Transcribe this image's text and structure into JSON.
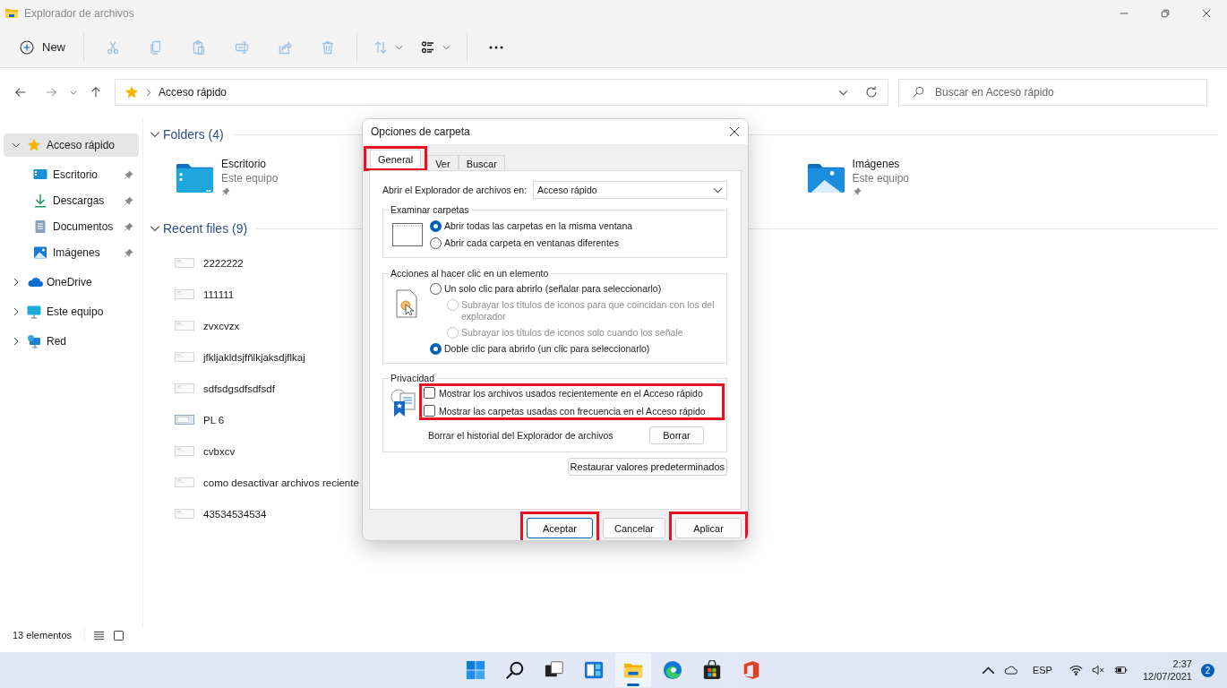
{
  "window": {
    "title": "Explorador de archivos"
  },
  "toolbar": [
    {
      "kind": "new",
      "label": "New",
      "disabled": false
    },
    {
      "kind": "cut",
      "disabled": true
    },
    {
      "kind": "copy",
      "disabled": true
    },
    {
      "kind": "paste",
      "disabled": true
    },
    {
      "kind": "rename",
      "disabled": true
    },
    {
      "kind": "share",
      "disabled": true
    },
    {
      "kind": "delete",
      "disabled": true
    },
    {
      "kind": "sort",
      "disabled": true
    },
    {
      "kind": "view",
      "disabled": false
    },
    {
      "kind": "more",
      "disabled": false
    }
  ],
  "address": {
    "path": "Acceso rápido"
  },
  "search": {
    "placeholder": "Buscar en Acceso rápido"
  },
  "sidebar": {
    "items": [
      {
        "label": "Acceso rápido",
        "kind": "star",
        "expanded": true,
        "selected": true,
        "children": [
          {
            "label": "Escritorio",
            "kind": "desktop",
            "pinned": true,
            "selected": false
          },
          {
            "label": "Descargas",
            "kind": "download",
            "pinned": true,
            "selected": false
          },
          {
            "label": "Documentos",
            "kind": "document",
            "pinned": true,
            "selected": false
          },
          {
            "label": "Imágenes",
            "kind": "image",
            "pinned": true,
            "selected": false
          }
        ]
      },
      {
        "label": "OneDrive",
        "kind": "cloud",
        "expanded": false,
        "selected": false
      },
      {
        "label": "Este equipo",
        "kind": "monitor",
        "expanded": false,
        "selected": false
      },
      {
        "label": "Red",
        "kind": "network",
        "expanded": false,
        "selected": false
      }
    ]
  },
  "folders": {
    "title": "Folders (4)",
    "expanded": true,
    "items": [
      {
        "name": "Escritorio",
        "location": "Este equipo",
        "kind": "desktop",
        "pinned": true
      },
      {
        "name": "Imágenes",
        "location": "Este equipo",
        "kind": "image",
        "pinned": true
      }
    ]
  },
  "recent": {
    "title": "Recent files (9)",
    "expanded": true,
    "files": [
      {
        "name": "2222222",
        "kind": "doc"
      },
      {
        "name": "111111",
        "kind": "doc"
      },
      {
        "name": "zvxcvzx",
        "kind": "doc"
      },
      {
        "name": "jfkljakldsjfñlkjaksdjflkaj",
        "kind": "doc"
      },
      {
        "name": "sdfsdgsdfsdfsdf",
        "kind": "doc"
      },
      {
        "name": "PL 6",
        "kind": "screen"
      },
      {
        "name": "cvbxcv",
        "kind": "doc"
      },
      {
        "name": "como desactivar archivos reciente",
        "kind": "doc"
      },
      {
        "name": "43534534534",
        "kind": "doc"
      }
    ]
  },
  "status_bar": {
    "count": "13 elementos"
  },
  "dialog": {
    "title": "Opciones de carpeta",
    "tabs": [
      {
        "label": "General",
        "selected": true,
        "highlighted": true
      },
      {
        "label": "Ver",
        "selected": false,
        "highlighted": false
      },
      {
        "label": "Buscar",
        "selected": false,
        "highlighted": false
      }
    ],
    "open_in": {
      "label": "Abrir el Explorador de archivos en:",
      "value": "Acceso rápido"
    },
    "groups": [
      {
        "title": "Examinar carpetas",
        "kind": "browse",
        "options": [
          {
            "label": "Abrir todas las carpetas en la misma ventana",
            "selected": true,
            "disabled": false
          },
          {
            "label": "Abrir cada carpeta en ventanas diferentes",
            "selected": false,
            "disabled": false
          }
        ]
      },
      {
        "title": "Acciones al hacer clic en un elemento",
        "kind": "click",
        "options": [
          {
            "label": "Un solo clic para abrirlo (señalar para seleccionarlo)",
            "selected": false,
            "disabled": false,
            "children": [
              {
                "label": "Subrayar los títulos de iconos para que coincidan con los del explorador",
                "selected": false,
                "disabled": true
              },
              {
                "label": "Subrayar los títulos de iconos solo cuando los señale",
                "selected": false,
                "disabled": true
              }
            ]
          },
          {
            "label": "Doble clic para abrirlo (un clic para seleccionarlo)",
            "selected": true,
            "disabled": false
          }
        ]
      },
      {
        "title": "Privacidad",
        "kind": "privacy",
        "highlighted": true,
        "checkboxes": [
          {
            "label": "Mostrar los archivos usados recientemente en el Acceso rápido",
            "checked": false
          },
          {
            "label": "Mostrar las carpetas usadas con frecuencia en el Acceso rápido",
            "checked": false
          }
        ],
        "clear_label": "Borrar el historial del Explorador de archivos",
        "clear_button": "Borrar"
      }
    ],
    "restore_button": "Restaurar valores predeterminados",
    "buttons": [
      {
        "label": "Aceptar",
        "default": true,
        "highlighted": true
      },
      {
        "label": "Cancelar",
        "default": false,
        "highlighted": false
      },
      {
        "label": "Aplicar",
        "default": false,
        "highlighted": true
      }
    ]
  },
  "taskbar": {
    "apps": [
      {
        "kind": "start",
        "active": false
      },
      {
        "kind": "search",
        "active": false
      },
      {
        "kind": "taskview",
        "active": false
      },
      {
        "kind": "widgets",
        "active": false
      },
      {
        "kind": "explorer",
        "active": true
      },
      {
        "kind": "browser",
        "active": false
      },
      {
        "kind": "store",
        "active": false
      },
      {
        "kind": "office",
        "active": false
      }
    ],
    "language": "ESP",
    "time": "2:37",
    "date": "12/07/2021",
    "notifications": "2"
  }
}
